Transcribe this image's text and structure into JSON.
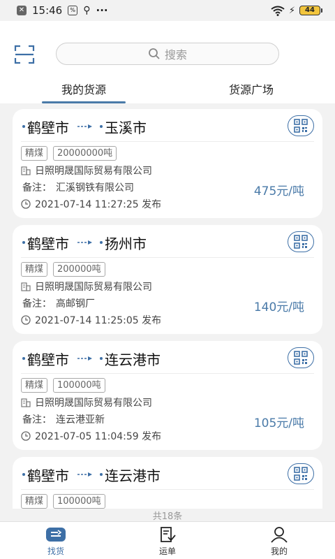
{
  "statusbar": {
    "time": "15:46",
    "battery": "44"
  },
  "header": {
    "search_placeholder": "搜索",
    "tabs": [
      {
        "label": "我的货源",
        "active": true
      },
      {
        "label": "货源广场",
        "active": false
      }
    ]
  },
  "cards": [
    {
      "from": "鹤壁市",
      "to": "玉溪市",
      "tags": [
        "精煤",
        "20000000吨"
      ],
      "company": "日照明晟国际贸易有限公司",
      "note_label": "备注：",
      "note": "汇溪钢铁有限公司",
      "time": "2021-07-14 11:27:25 发布",
      "price": "475元/吨"
    },
    {
      "from": "鹤壁市",
      "to": "扬州市",
      "tags": [
        "精煤",
        "200000吨"
      ],
      "company": "日照明晟国际贸易有限公司",
      "note_label": "备注：",
      "note": "高邮钢厂",
      "time": "2021-07-14 11:25:05 发布",
      "price": "140元/吨"
    },
    {
      "from": "鹤壁市",
      "to": "连云港市",
      "tags": [
        "精煤",
        "100000吨"
      ],
      "company": "日照明晟国际贸易有限公司",
      "note_label": "备注：",
      "note": "连云港亚新",
      "time": "2021-07-05 11:04:59 发布",
      "price": "105元/吨"
    },
    {
      "from": "鹤壁市",
      "to": "连云港市",
      "tags": [
        "精煤",
        "100000吨"
      ]
    }
  ],
  "total": "共18条",
  "nav": [
    {
      "label": "找货",
      "icon": "truck-icon",
      "active": true
    },
    {
      "label": "运单",
      "icon": "waybill-icon",
      "active": false
    },
    {
      "label": "我的",
      "icon": "profile-icon",
      "active": false
    }
  ],
  "colors": {
    "accent": "#3d6fa6",
    "tab_indicator": "#4a7aa8",
    "price": "#4a7aa8",
    "battery": "#f2c53d"
  }
}
